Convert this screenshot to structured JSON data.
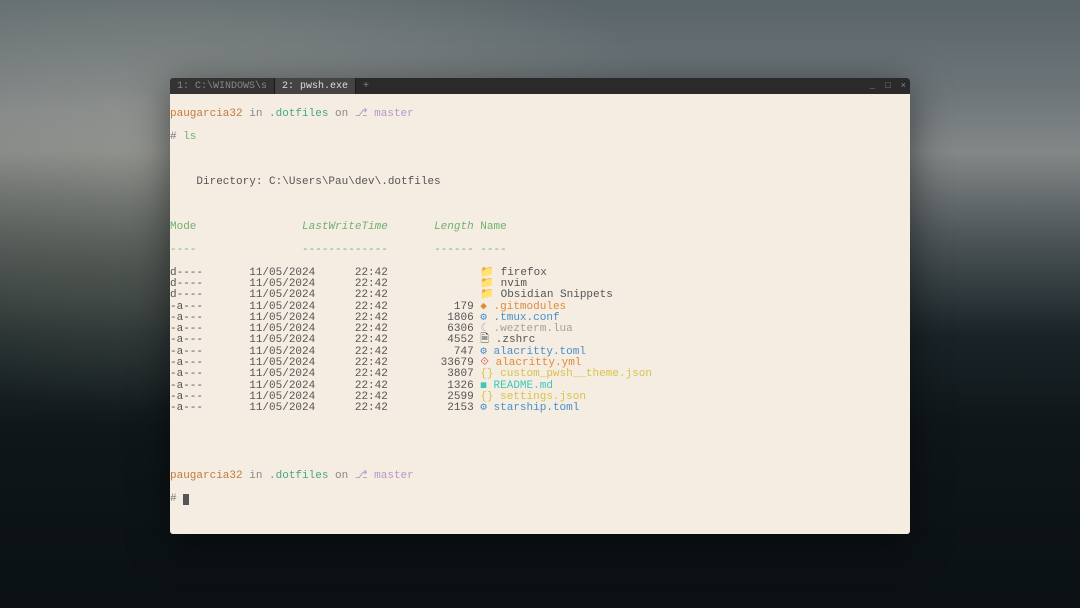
{
  "tabs": {
    "inactive": "1: C:\\WINDOWS\\s",
    "active": "2: pwsh.exe",
    "add": "+"
  },
  "win": {
    "min": "_",
    "max": "□",
    "close": "×"
  },
  "prompt": {
    "user": "paugarcia32",
    "in": " in ",
    "dir": ".dotfiles",
    "on": " on ",
    "branch_sym": "⎇ ",
    "branch": "master",
    "hash": "# ",
    "cmd": "ls"
  },
  "dir_line": "    Directory: C:\\Users\\Pau\\dev\\.dotfiles",
  "header": {
    "mode": "Mode",
    "lwt": "LastWriteTime",
    "length": "Length",
    "name": "Name",
    "mode_u": "----",
    "lwt_u": "-------------",
    "length_u": "------",
    "name_u": "----"
  },
  "rows": [
    {
      "mode": "d----",
      "date": "11/05/2024",
      "time": "22:42",
      "len": "",
      "icon": "📁",
      "iconClass": "c-folder-ic",
      "name": "firefox",
      "nameClass": "c-name"
    },
    {
      "mode": "d----",
      "date": "11/05/2024",
      "time": "22:42",
      "len": "",
      "icon": "📁",
      "iconClass": "c-folder-ic",
      "name": "nvim",
      "nameClass": "c-name"
    },
    {
      "mode": "d----",
      "date": "11/05/2024",
      "time": "22:42",
      "len": "",
      "icon": "📁",
      "iconClass": "c-folder-ic",
      "name": "Obsidian Snippets",
      "nameClass": "c-name"
    },
    {
      "mode": "-a---",
      "date": "11/05/2024",
      "time": "22:42",
      "len": "179",
      "icon": "◆",
      "iconClass": "c-git-ic",
      "name": ".gitmodules",
      "nameClass": "f-orange"
    },
    {
      "mode": "-a---",
      "date": "11/05/2024",
      "time": "22:42",
      "len": "1806",
      "icon": "⚙",
      "iconClass": "c-gear-ic",
      "name": ".tmux.conf",
      "nameClass": "f-blue"
    },
    {
      "mode": "-a---",
      "date": "11/05/2024",
      "time": "22:42",
      "len": "6306",
      "icon": "☾",
      "iconClass": "c-lua-ic",
      "name": ".wezterm.lua",
      "nameClass": "f-gray"
    },
    {
      "mode": "-a---",
      "date": "11/05/2024",
      "time": "22:42",
      "len": "4552",
      "icon": "🗎",
      "iconClass": "c-file-ic",
      "name": ".zshrc",
      "nameClass": "c-name"
    },
    {
      "mode": "-a---",
      "date": "11/05/2024",
      "time": "22:42",
      "len": "747",
      "icon": "⚙",
      "iconClass": "c-gear-ic",
      "name": "alacritty.toml",
      "nameClass": "f-blue"
    },
    {
      "mode": "-a---",
      "date": "11/05/2024",
      "time": "22:42",
      "len": "33679",
      "icon": "⟐",
      "iconClass": "c-yml-ic",
      "name": "alacritty.yml",
      "nameClass": "f-orange"
    },
    {
      "mode": "-a---",
      "date": "11/05/2024",
      "time": "22:42",
      "len": "3807",
      "icon": "{}",
      "iconClass": "c-json-ic",
      "name": "custom_pwsh__theme.json",
      "nameClass": "f-yellow"
    },
    {
      "mode": "-a---",
      "date": "11/05/2024",
      "time": "22:42",
      "len": "1326",
      "icon": "◼",
      "iconClass": "c-md-ic",
      "name": "README.md",
      "nameClass": "f-teal"
    },
    {
      "mode": "-a---",
      "date": "11/05/2024",
      "time": "22:42",
      "len": "2599",
      "icon": "{}",
      "iconClass": "c-json-ic",
      "name": "settings.json",
      "nameClass": "f-yellow"
    },
    {
      "mode": "-a---",
      "date": "11/05/2024",
      "time": "22:42",
      "len": "2153",
      "icon": "⚙",
      "iconClass": "c-gear-ic",
      "name": "starship.toml",
      "nameClass": "f-blue"
    }
  ]
}
